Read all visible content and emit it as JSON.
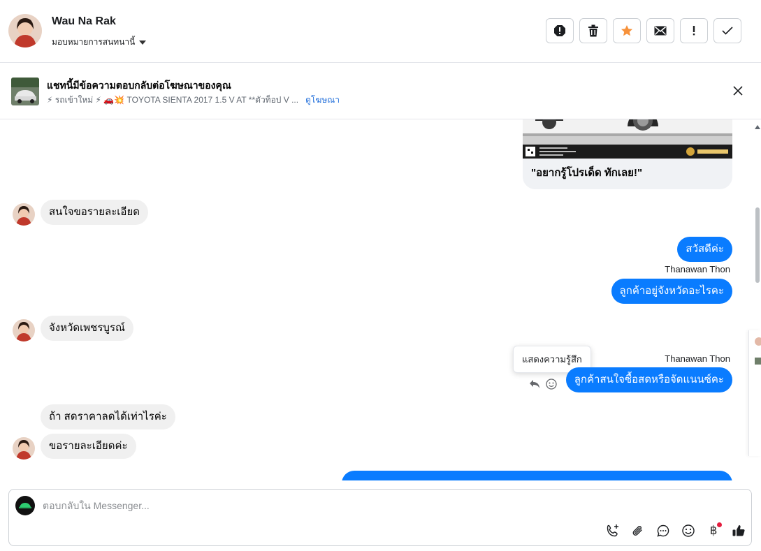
{
  "header": {
    "contact_name": "Wau Na Rak",
    "assign_label": "มอบหมายการสนทนานี้",
    "buttons": [
      "spam-icon",
      "trash-icon",
      "star-icon",
      "mail-icon",
      "exclamation-icon",
      "check-icon"
    ]
  },
  "ad_banner": {
    "title": "แชทนี้มีข้อความตอบกลับต่อโฆษณาของคุณ",
    "description": "⚡ รถเข้าใหม่ ⚡ 🚗💥 TOYOTA SIENTA 2017 1.5 V AT **ตัวท็อป V ...",
    "link": "ดูโฆษณา"
  },
  "messages": {
    "card_caption": "\"อยากรู้โปรเด็ด ทักเลย!\"",
    "m1": "สนใจขอรายละเอียด",
    "m2": "สวัสดีค่ะ",
    "sender1": "Thanawan Thon",
    "m3": "ลูกค้าอยู่จังหวัดอะไรคะ",
    "m4": "จังหวัดเพชรบูรณ์",
    "sender2": "Thanawan Thon",
    "m5": "ลูกค้าสนใจซื้อสดหรือจัดแนนซ์คะ",
    "m6": "ถ้า สดราคาลดได้เท่าไรค่ะ",
    "m7": "ขอรายละเอียดค่ะ",
    "tooltip": "แสดงความรู้สึก"
  },
  "composer": {
    "placeholder": "ตอบกลับใน Messenger...",
    "tools": [
      "phone-add-icon",
      "attach-icon",
      "saved-reply-icon",
      "emoji-icon",
      "baht-icon",
      "like-icon"
    ]
  },
  "colors": {
    "accent": "#0a7cff",
    "incoming_bubble": "#f0f0f0",
    "star": "#f7923b"
  }
}
